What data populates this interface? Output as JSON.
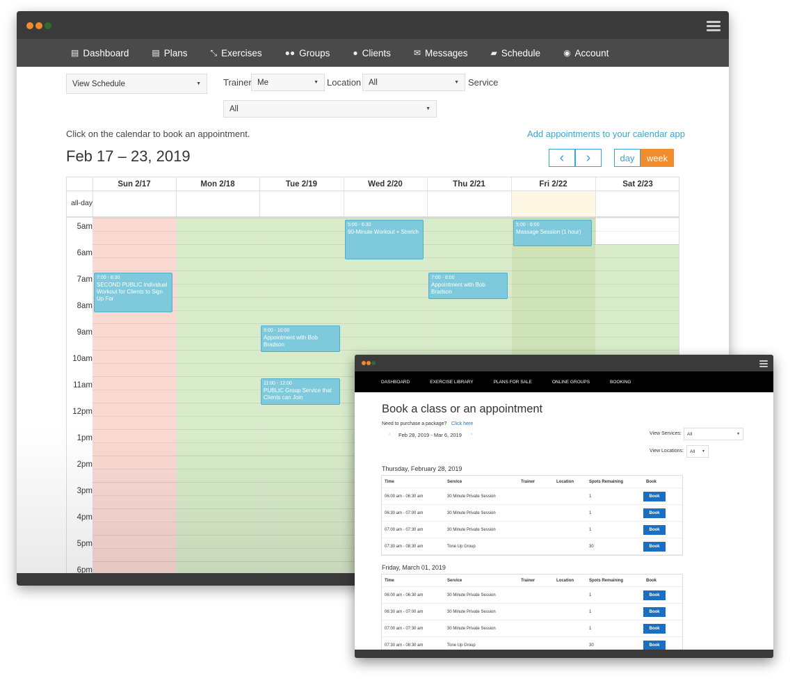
{
  "nav": [
    "Dashboard",
    "Plans",
    "Exercises",
    "Groups",
    "Clients",
    "Messages",
    "Schedule",
    "Account"
  ],
  "filters": {
    "view": "View Schedule",
    "trainer_label": "Trainer",
    "trainer": "Me",
    "location_label": "Location",
    "location": "All",
    "service_label": "Service",
    "service": "All"
  },
  "hint": "Click on the calendar to book an appointment.",
  "add_link": "Add appointments to your calendar app",
  "date_range": "Feb 17 – 23, 2019",
  "prev": "‹",
  "next": "›",
  "day": "day",
  "week": "week",
  "days": [
    "Sun 2/17",
    "Mon 2/18",
    "Tue 2/19",
    "Wed 2/20",
    "Thu 2/21",
    "Fri 2/22",
    "Sat 2/23"
  ],
  "allday": "all-day",
  "hours": [
    "5am",
    "6am",
    "7am",
    "8am",
    "9am",
    "10am",
    "11am",
    "12pm",
    "1pm",
    "2pm",
    "3pm",
    "4pm",
    "5pm",
    "6pm"
  ],
  "events": [
    {
      "time": "7:00 - 8:30",
      "title": "SECOND PUBLIC Individual Workout for Clients to Sign Up For"
    },
    {
      "time": "5:00 - 6:30",
      "title": "90-Minute Workout + Stretch"
    },
    {
      "time": "5:00 - 6:00",
      "title": "Massage Session (1 hour)"
    },
    {
      "time": "7:00 - 8:00",
      "title": "Appointment with Bob Bradson"
    },
    {
      "time": "9:00 - 10:00",
      "title": "Appointment with Bob Bradson"
    },
    {
      "time": "11:00 - 12:00",
      "title": "PUBLIC Group Service that Clients can Join"
    }
  ],
  "colors": {
    "accent": "#3aa3d4",
    "week": "#f08c2e",
    "sunday": "#fbd9d3",
    "available": "#d8ecc9",
    "today": "#fdf7e3"
  },
  "w2": {
    "nav": [
      "DASHBOARD",
      "EXERCISE LIBRARY",
      "PLANS FOR SALE",
      "ONLINE GROUPS",
      "BOOKING"
    ],
    "title": "Book a class or an appointment",
    "need": "Need to purchase a package?",
    "click": "Click here",
    "range": "Feb 28, 2019 - Mar 6, 2019",
    "svc_label": "View Services:",
    "svc": "All",
    "loc_label": "View Locations:",
    "loc": "All",
    "headers": [
      "Time",
      "Service",
      "Trainer",
      "Location",
      "Spots Remaining",
      "Book"
    ],
    "book": "Book",
    "day1": "Thursday, February 28, 2019",
    "rows1": [
      [
        "06:00 am - 06:30 am",
        "30 Minute Private Session",
        "1"
      ],
      [
        "06:30 am - 07:00 am",
        "30 Minute Private Session",
        "1"
      ],
      [
        "07:00 am - 07:30 am",
        "30 Minute Private Session",
        "1"
      ],
      [
        "07:30 am - 08:30 am",
        "Tone Up Group",
        "30"
      ]
    ],
    "day2": "Friday, March 01, 2019",
    "rows2": [
      [
        "06:00 am - 06:30 am",
        "30 Minute Private Session",
        "1"
      ],
      [
        "06:30 am - 07:00 am",
        "30 Minute Private Session",
        "1"
      ],
      [
        "07:00 am - 07:30 am",
        "30 Minute Private Session",
        "1"
      ],
      [
        "07:30 am - 08:30 am",
        "Tone Up Group",
        "30"
      ]
    ]
  }
}
